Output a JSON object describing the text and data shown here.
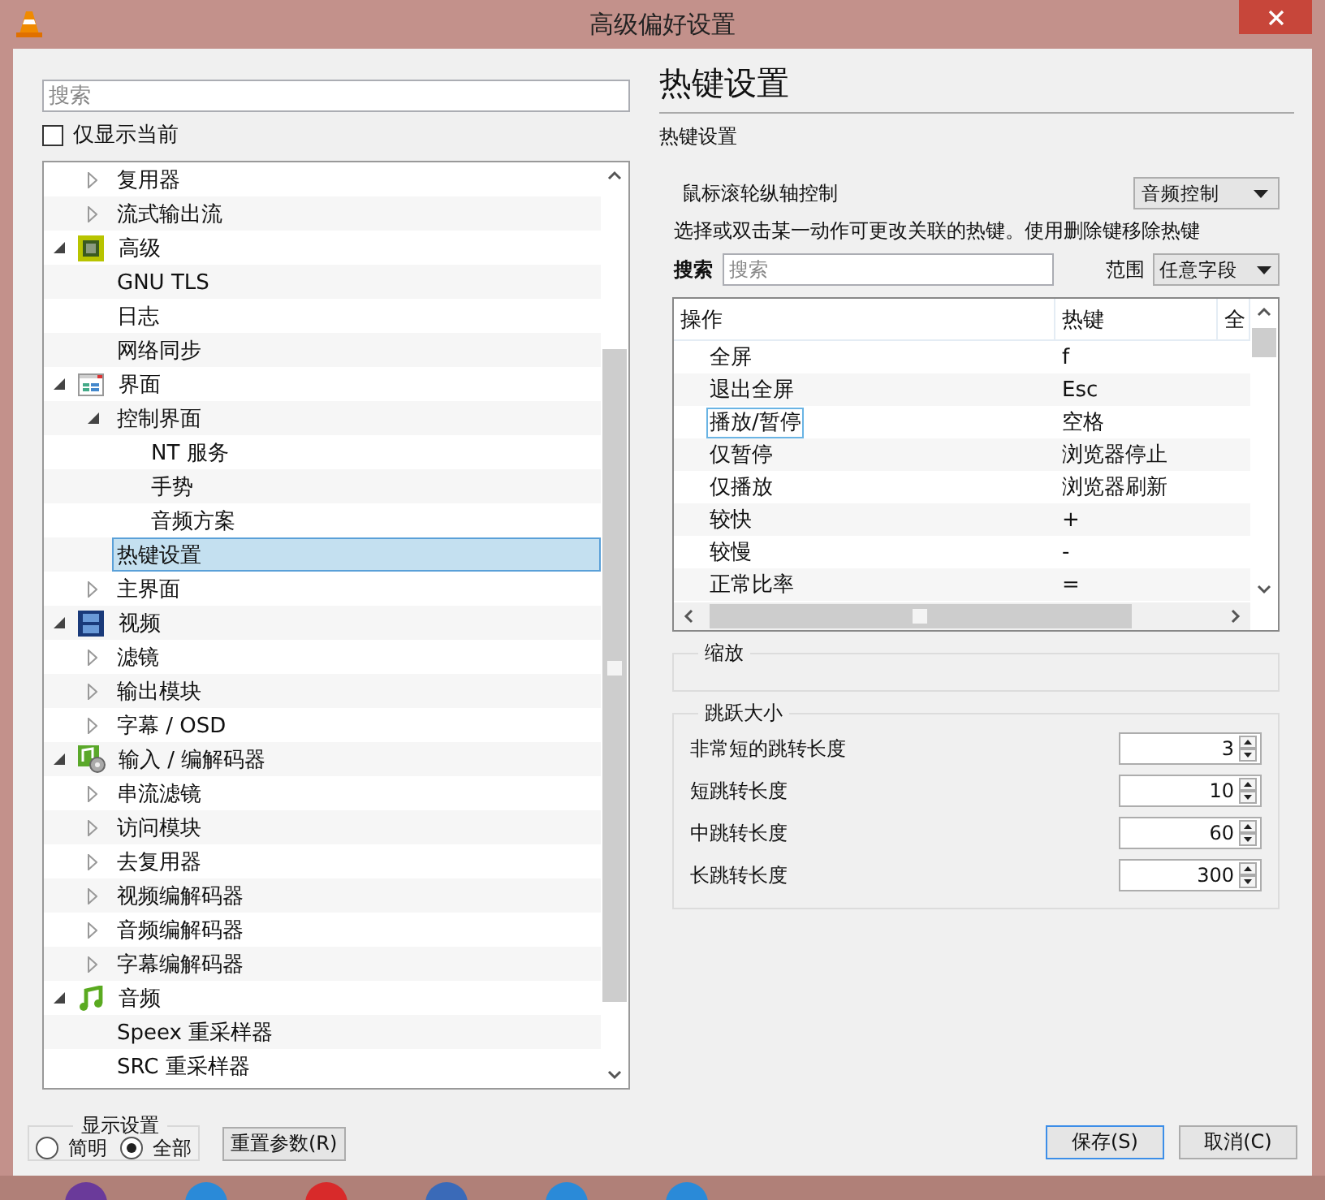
{
  "window": {
    "title": "高级偏好设置"
  },
  "sidebar": {
    "search": {
      "placeholder": "搜索"
    },
    "only_current": {
      "label": "仅显示当前",
      "checked": false
    },
    "tree": [
      {
        "children": [
          {
            "label": "复用器",
            "expanded": false,
            "selected": false
          },
          {
            "label": "流式输出流",
            "expanded": false,
            "selected": false
          }
        ]
      },
      {
        "label": "高级",
        "expanded": true,
        "selected": false,
        "children": [
          {
            "label": "GNU TLS",
            "selected": false
          },
          {
            "label": "日志",
            "selected": false
          },
          {
            "label": "网络同步",
            "selected": false
          }
        ]
      },
      {
        "label": "界面",
        "expanded": true,
        "selected": false,
        "children": [
          {
            "label": "控制界面",
            "expanded": true,
            "selected": false,
            "children": [
              {
                "label": "NT 服务",
                "selected": false
              },
              {
                "label": "手势",
                "selected": false
              },
              {
                "label": "音频方案",
                "selected": false
              }
            ]
          },
          {
            "label": "热键设置",
            "selected": true
          },
          {
            "label": "主界面",
            "expanded": false,
            "selected": false
          }
        ]
      },
      {
        "label": "视频",
        "expanded": true,
        "selected": false,
        "children": [
          {
            "label": "滤镜",
            "expanded": false,
            "selected": false
          },
          {
            "label": "输出模块",
            "expanded": false,
            "selected": false
          },
          {
            "label": "字幕 / OSD",
            "expanded": false,
            "selected": false
          }
        ]
      },
      {
        "label": "输入 / 编解码器",
        "expanded": true,
        "selected": false,
        "children": [
          {
            "label": "串流滤镜",
            "expanded": false,
            "selected": false
          },
          {
            "label": "访问模块",
            "expanded": false,
            "selected": false
          },
          {
            "label": "去复用器",
            "expanded": false,
            "selected": false
          },
          {
            "label": "视频编解码器",
            "expanded": false,
            "selected": false
          },
          {
            "label": "音频编解码器",
            "expanded": false,
            "selected": false
          },
          {
            "label": "字幕编解码器",
            "expanded": false,
            "selected": false
          }
        ]
      },
      {
        "label": "音频",
        "expanded": true,
        "selected": false,
        "children": [
          {
            "label": "Speex 重采样器",
            "selected": false
          },
          {
            "label": "SRC 重采样器",
            "selected": false
          }
        ]
      }
    ],
    "display": {
      "title": "显示设置",
      "options": [
        {
          "label": "简明",
          "selected": false
        },
        {
          "label": "全部",
          "selected": true
        }
      ]
    },
    "reset_button": "重置参数(R)"
  },
  "panel": {
    "title": "热键设置",
    "subtitle": "热键设置",
    "wheel": {
      "label": "鼠标滚轮纵轴控制",
      "value": "音频控制"
    },
    "hint": "选择或双击某一动作可更改关联的热键。使用删除键移除热键",
    "search": {
      "label": "搜索",
      "placeholder": "搜索"
    },
    "scope": {
      "label": "范围",
      "value": "任意字段"
    },
    "table": {
      "columns": [
        "操作",
        "热键",
        "全"
      ],
      "rows": [
        {
          "action": "全屏",
          "hotkey": "f",
          "selected": false
        },
        {
          "action": "退出全屏",
          "hotkey": "Esc",
          "selected": false
        },
        {
          "action": "播放/暂停",
          "hotkey": "空格",
          "selected": true
        },
        {
          "action": "仅暂停",
          "hotkey": "浏览器停止",
          "selected": false
        },
        {
          "action": "仅播放",
          "hotkey": "浏览器刷新",
          "selected": false
        },
        {
          "action": "较快",
          "hotkey": "+",
          "selected": false
        },
        {
          "action": "较慢",
          "hotkey": "-",
          "selected": false
        },
        {
          "action": "正常比率",
          "hotkey": "=",
          "selected": false
        }
      ]
    },
    "zoom_group": {
      "title": "缩放"
    },
    "jump_group": {
      "title": "跳跃大小",
      "fields": [
        {
          "label": "非常短的跳转长度",
          "value": "3"
        },
        {
          "label": "短跳转长度",
          "value": "10"
        },
        {
          "label": "中跳转长度",
          "value": "60"
        },
        {
          "label": "长跳转长度",
          "value": "300"
        }
      ]
    }
  },
  "buttons": [
    {
      "label": "保存(S)",
      "default": true
    },
    {
      "label": "取消(C)",
      "default": false
    }
  ]
}
